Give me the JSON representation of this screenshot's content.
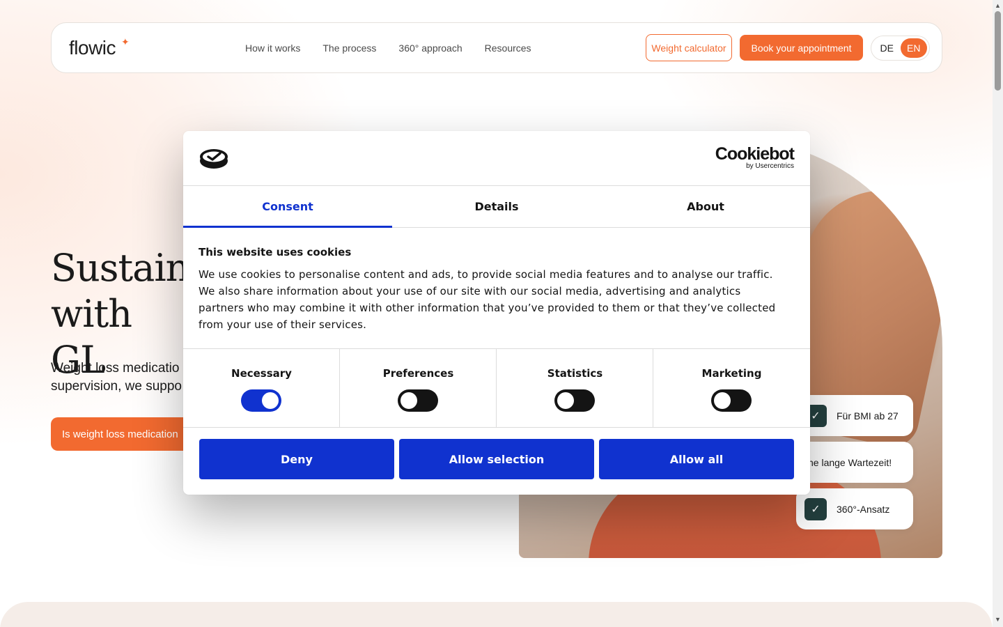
{
  "header": {
    "logo": "flowic",
    "nav": [
      "How it works",
      "The process",
      "360° approach",
      "Resources"
    ],
    "weight_calculator": "Weight calculator",
    "book_appointment": "Book your appointment",
    "lang": [
      "DE",
      "EN"
    ],
    "active_lang": "EN"
  },
  "hero": {
    "title": "Sustaina\nwith GL",
    "subtitle": "Weight loss medicatio\nsupervision, we suppo",
    "cta": "Is weight loss medication"
  },
  "pills": [
    "Für BMI ab 27",
    "ne lange Wartezeit!",
    "360°-Ansatz"
  ],
  "cookie_dialog": {
    "brand": "Cookiebot",
    "brand_by": "by Usercentrics",
    "tabs": [
      "Consent",
      "Details",
      "About"
    ],
    "active_tab": "Consent",
    "heading": "This website uses cookies",
    "body": "We use cookies to personalise content and ads, to provide social media features and to analyse our traffic. We also share information about your use of our site with our social media, advertising and analytics partners who may combine it with other information that you’ve provided to them or that they’ve collected from your use of their services.",
    "categories": [
      {
        "label": "Necessary",
        "enabled": true
      },
      {
        "label": "Preferences",
        "enabled": false
      },
      {
        "label": "Statistics",
        "enabled": false
      },
      {
        "label": "Marketing",
        "enabled": false
      }
    ],
    "buttons": [
      "Deny",
      "Allow selection",
      "Allow all"
    ]
  },
  "colors": {
    "brand_orange": "#f26a30",
    "cookiebot_blue": "#1032cf",
    "check_green": "#24403f"
  },
  "icons": [
    "check-icon",
    "cookiebot-logo-icon",
    "scroll-up-icon",
    "scroll-down-icon"
  ]
}
